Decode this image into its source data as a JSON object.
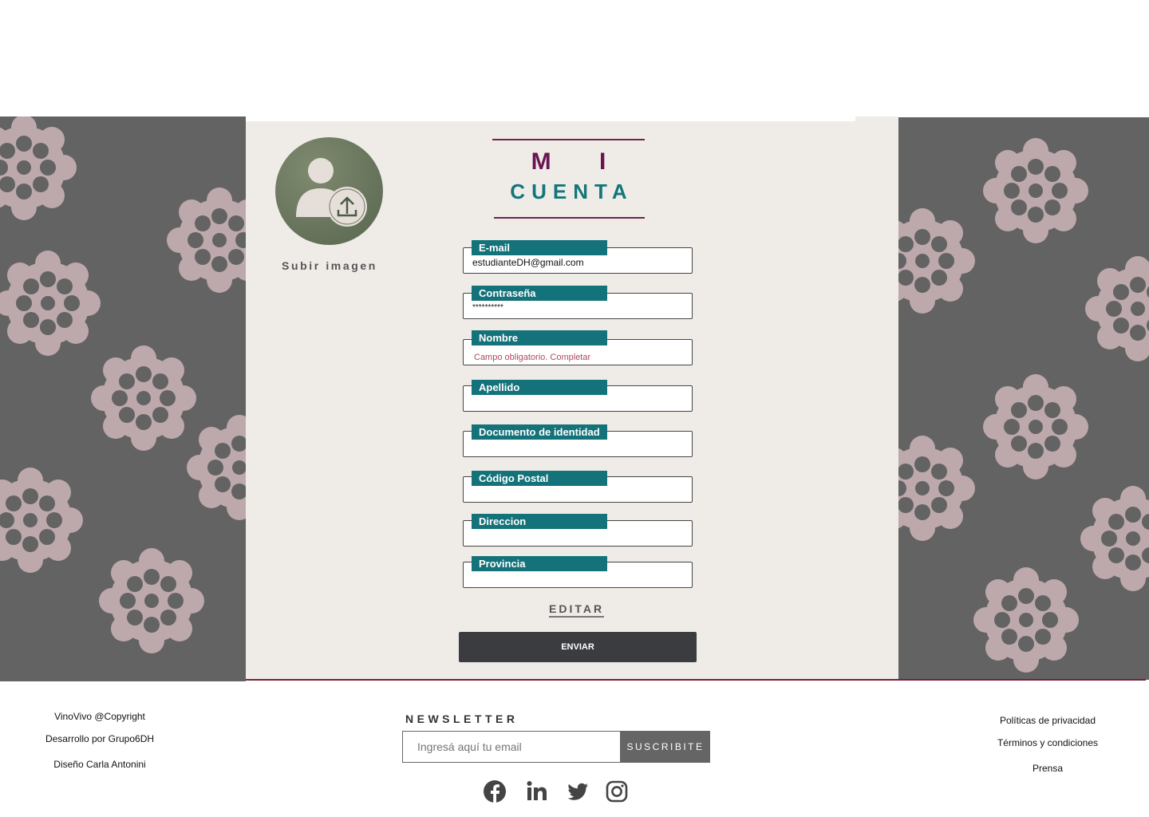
{
  "page": {
    "avatar_upload_label": "Subir imagen",
    "title_line1": "M I",
    "title_line2": "CUENTA"
  },
  "form": {
    "fields": [
      {
        "label": "E-mail",
        "value": "estudianteDH@gmail.com",
        "error": ""
      },
      {
        "label": "Contraseña",
        "value": "**********",
        "error": ""
      },
      {
        "label": "Nombre",
        "value": "",
        "error": "Campo obligatorio. Completar"
      },
      {
        "label": "Apellido",
        "value": "",
        "error": ""
      },
      {
        "label": "Documento de identidad",
        "value": "",
        "error": ""
      },
      {
        "label": "Código Postal",
        "value": "",
        "error": ""
      },
      {
        "label": "Direccion",
        "value": "",
        "error": ""
      },
      {
        "label": "Provincia",
        "value": "",
        "error": ""
      }
    ],
    "edit_label": "EDITAR",
    "submit_label": "ENVIAR"
  },
  "footer": {
    "left": [
      "VinoVivo @Copyright",
      "Desarrollo por Grupo6DH",
      "Diseño Carla Antonini"
    ],
    "newsletter_title": "NEWSLETTER",
    "newsletter_placeholder": "Ingresá aquí tu email",
    "newsletter_button": "SUSCRIBITE",
    "right": [
      "Políticas de privacidad",
      "Términos y condiciones",
      "Prensa"
    ],
    "social_icons": [
      "facebook-icon",
      "linkedin-icon",
      "twitter-icon",
      "instagram-icon"
    ]
  },
  "colors": {
    "teal": "#13727a",
    "maroon": "#6b1450",
    "side_gray": "#636363",
    "panel_bg": "#efece8",
    "flower": "#bfaeae"
  }
}
